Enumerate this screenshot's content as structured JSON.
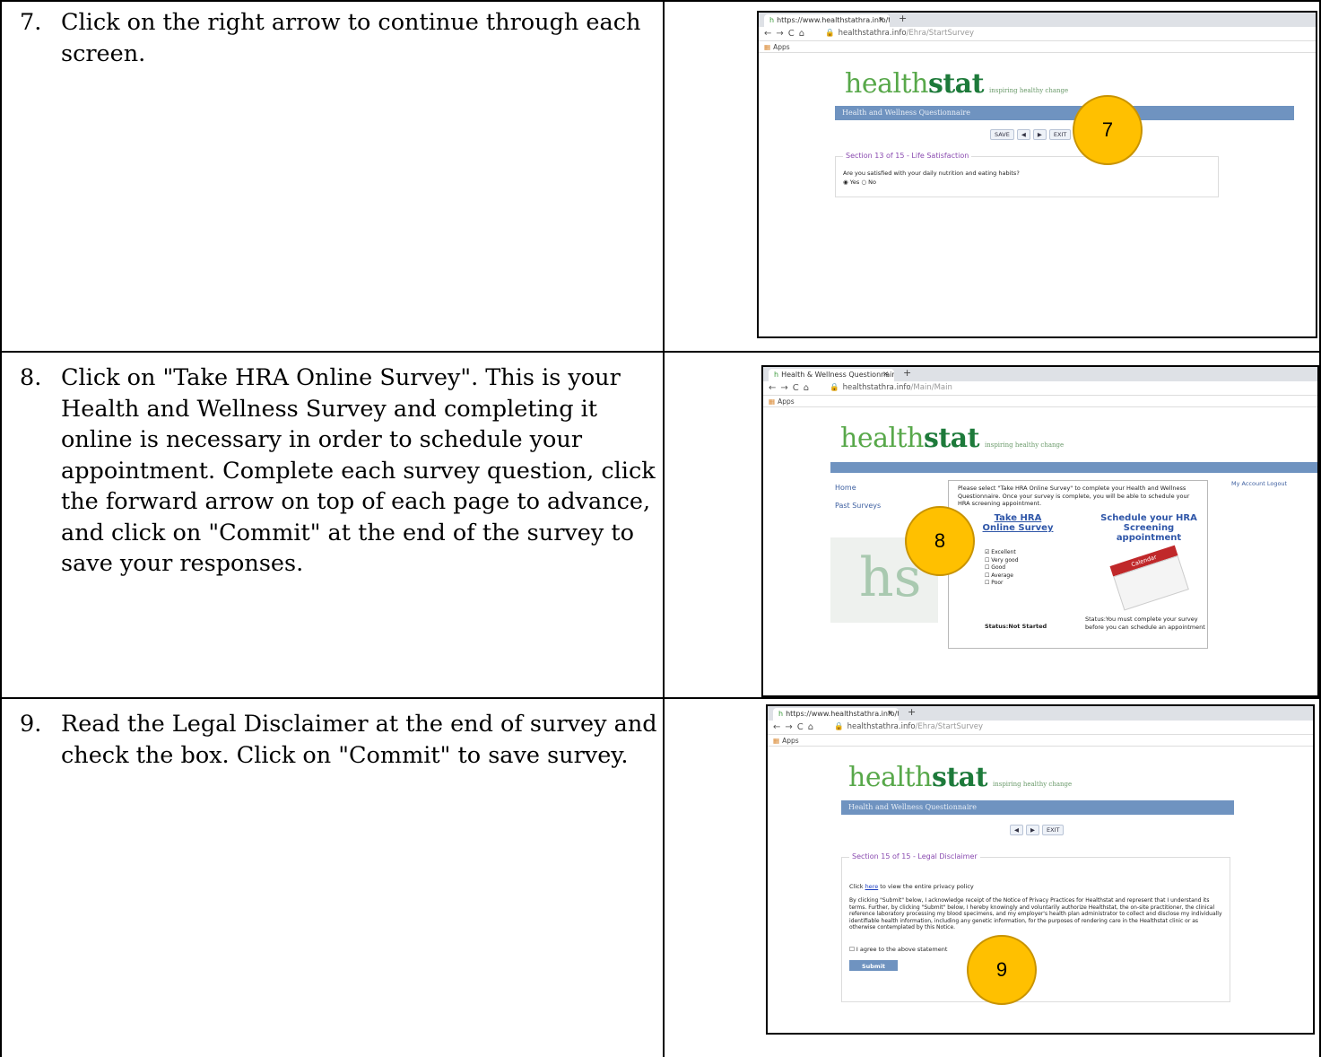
{
  "steps": [
    {
      "number": "7.",
      "text": "Click on the right arrow to continue through each screen.",
      "screenshot": {
        "tab_title": "https://www.healthstathra.info/t",
        "url_host": "healthstathra.info",
        "url_path": "/Ehra/StartSurvey",
        "bookmarks": "Apps",
        "logo_health": "health",
        "logo_stat": "stat",
        "tagline": "inspiring healthy change",
        "bar_title": "Health and Wellness Questionnaire",
        "controls": [
          "SAVE",
          "◀",
          "▶",
          "EXIT"
        ],
        "section": "Section 13 of 15 - Life Satisfaction",
        "question": "Are you satisfied with your daily nutrition and eating habits?",
        "options": [
          "Yes",
          "No"
        ],
        "badge": "7"
      }
    },
    {
      "number": "8.",
      "text": "Click on \"Take HRA Online Survey\". This is your Health and Wellness Survey and completing it online is necessary in order to schedule your appointment. Complete each survey question, click the forward arrow on top of each page to advance, and click on \"Commit\" at the end of the survey to save your responses.",
      "screenshot": {
        "tab_title": "Health & Wellness Questionnaire",
        "url_host": "healthstathra.info",
        "url_path": "/Main/Main",
        "bookmarks": "Apps",
        "logo_health": "health",
        "logo_stat": "stat",
        "tagline": "inspiring healthy change",
        "nav": [
          "Home",
          "Past Surveys"
        ],
        "account_links": "My Account Logout",
        "intro": "Please select \"Take HRA Online Survey\" to complete your Health and Wellness Questionnaire. Once your survey is complete, you will be able to schedule your HRA screening appointment.",
        "take_title": "Take HRA Online Survey",
        "schedule_title": "Schedule your HRA Screening appointment",
        "checklist": [
          "Excellent",
          "Very good",
          "Good",
          "Average",
          "Poor"
        ],
        "calendar_word": "Calendar",
        "status_left": "Status:Not Started",
        "status_right": "Status:You must complete your survey before you can schedule an appointment",
        "badge": "8"
      }
    },
    {
      "number": "9.",
      "text": "Read the Legal Disclaimer at the end of survey and check the box. Click on \"Commit\" to save survey.",
      "screenshot": {
        "tab_title": "https://www.healthstathra.info/t",
        "url_host": "healthstathra.info",
        "url_path": "/Ehra/StartSurvey",
        "bookmarks": "Apps",
        "logo_health": "health",
        "logo_stat": "stat",
        "tagline": "inspiring healthy change",
        "bar_title": "Health and Wellness Questionnaire",
        "controls": [
          "◀",
          "▶",
          "EXIT"
        ],
        "section": "Section 15 of 15 - Legal Disclaimer",
        "privacy_pre": "Click ",
        "privacy_link": "here",
        "privacy_post": " to view the entire privacy policy",
        "disclaimer": "By clicking \"Submit\" below, I acknowledge receipt of the Notice of Privacy Practices for Healthstat and represent that I understand its terms. Further, by clicking \"Submit\" below, I hereby knowingly and voluntarily authorize Healthstat, the on-site practitioner, the clinical reference laboratory processing my blood specimens, and my employer's health plan administrator to collect and disclose my individually identifiable health information, including any genetic information, for the purposes of rendering care in the Healthstat clinic or as otherwise contemplated by this Notice.",
        "agree": "I agree to the above statement",
        "submit": "Submit",
        "badge": "9"
      }
    }
  ]
}
